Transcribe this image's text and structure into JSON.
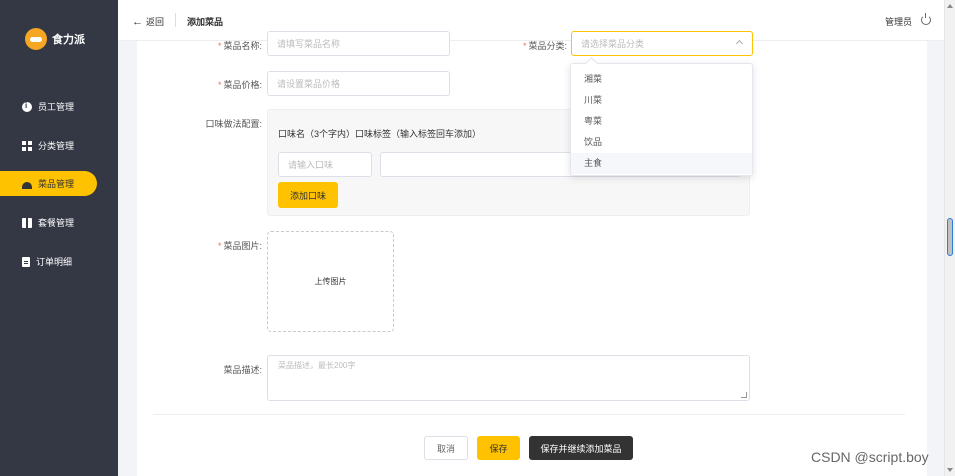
{
  "sidebar": {
    "logo_text": "食力派",
    "items": [
      {
        "label": "员工管理",
        "icon": "info-circle-icon"
      },
      {
        "label": "分类管理",
        "icon": "grid-icon"
      },
      {
        "label": "菜品管理",
        "icon": "cloche-icon",
        "active": true
      },
      {
        "label": "套餐管理",
        "icon": "gift-icon"
      },
      {
        "label": "订单明细",
        "icon": "clipboard-icon"
      }
    ]
  },
  "header": {
    "back_label": "返回",
    "title": "添加菜品",
    "user": "管理员"
  },
  "form": {
    "name_label": "菜品名称:",
    "name_placeholder": "请填写菜品名称",
    "category_label": "菜品分类:",
    "category_placeholder": "请选择菜品分类",
    "price_label": "菜品价格:",
    "price_placeholder": "请设置菜品价格",
    "flavor_label": "口味做法配置:",
    "flavor_header": "口味名（3个字内）口味标签（输入标签回车添加）",
    "flavor_name_placeholder": "请输入口味",
    "add_flavor_button": "添加口味",
    "image_label": "菜品图片:",
    "upload_text": "上传图片",
    "desc_label": "菜品描述:",
    "desc_placeholder": "菜品描述，最长200字"
  },
  "category_options": [
    "湘菜",
    "川菜",
    "粤菜",
    "饮品",
    "主食"
  ],
  "category_hovered": "主食",
  "buttons": {
    "cancel": "取消",
    "save": "保存",
    "save_continue": "保存并继续添加菜品"
  },
  "watermark": "CSDN @script.boy",
  "colors": {
    "accent": "#ffc200",
    "sidebar_bg": "#343744",
    "required": "#f56c6c"
  }
}
